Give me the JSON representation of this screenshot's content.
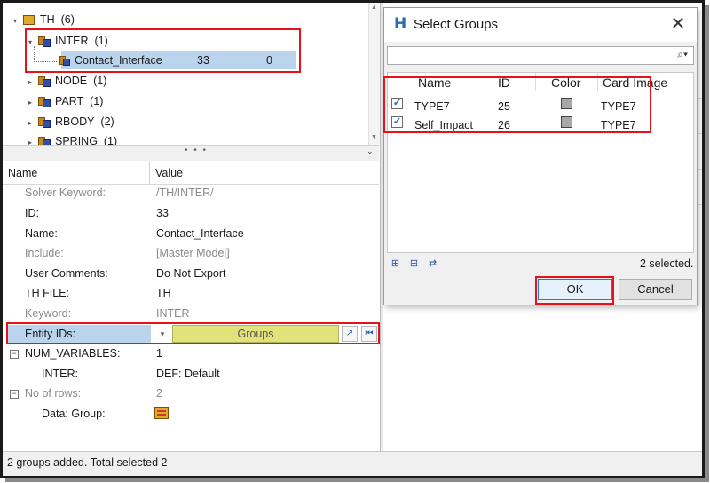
{
  "tree": {
    "items": [
      {
        "label": "TH",
        "count": "(6)"
      },
      {
        "label": "INTER",
        "count": "(1)"
      },
      {
        "label": "Contact_Interface",
        "id": "33",
        "extra": "0"
      },
      {
        "label": "NODE",
        "count": "(1)"
      },
      {
        "label": "PART",
        "count": "(1)"
      },
      {
        "label": "RBODY",
        "count": "(2)"
      },
      {
        "label": "SPRING",
        "count": "(1)"
      }
    ]
  },
  "splitter": {
    "dots": "• • •",
    "collapse": "⌄"
  },
  "props": {
    "header": {
      "name": "Name",
      "value": "Value"
    },
    "rows": [
      {
        "name": "Solver Keyword:",
        "value": "/TH/INTER/"
      },
      {
        "name": "ID:",
        "value": "33"
      },
      {
        "name": "Name:",
        "value": "Contact_Interface"
      },
      {
        "name": "Include:",
        "value": "[Master Model]"
      },
      {
        "name": "User Comments:",
        "value": "Do Not Export"
      },
      {
        "name": "TH FILE:",
        "value": "TH"
      },
      {
        "name": "Keyword:",
        "value": "INTER"
      },
      {
        "name": "Entity IDs:",
        "value": "Groups"
      },
      {
        "name": "NUM_VARIABLES:",
        "value": "1"
      },
      {
        "name": "INTER:",
        "value": "DEF: Default"
      },
      {
        "name": "No of rows:",
        "value": "2"
      },
      {
        "name": "Data: Group:",
        "value": ""
      }
    ]
  },
  "status": {
    "text": "2 groups added. Total selected 2"
  },
  "dialog": {
    "title": "Select Groups",
    "close_glyph": "✕",
    "search_placeholder": "",
    "search_icon_glyph": "⌕▾",
    "columns": [
      "Name",
      "ID",
      "Color",
      "Card Image"
    ],
    "rows": [
      {
        "name": "TYPE7",
        "id": "25",
        "color": "#a8a8a8",
        "card_image": "TYPE7",
        "checked": true
      },
      {
        "name": "Self_Impact",
        "id": "26",
        "color": "#a8a8a8",
        "card_image": "TYPE7",
        "checked": true
      }
    ],
    "selected_text": "2 selected.",
    "ok_label": "OK",
    "cancel_label": "Cancel"
  },
  "colors": {
    "highlight": "#b9d4ec",
    "red_annotation": "#e8101a",
    "groups_field": "#e2e27a"
  }
}
